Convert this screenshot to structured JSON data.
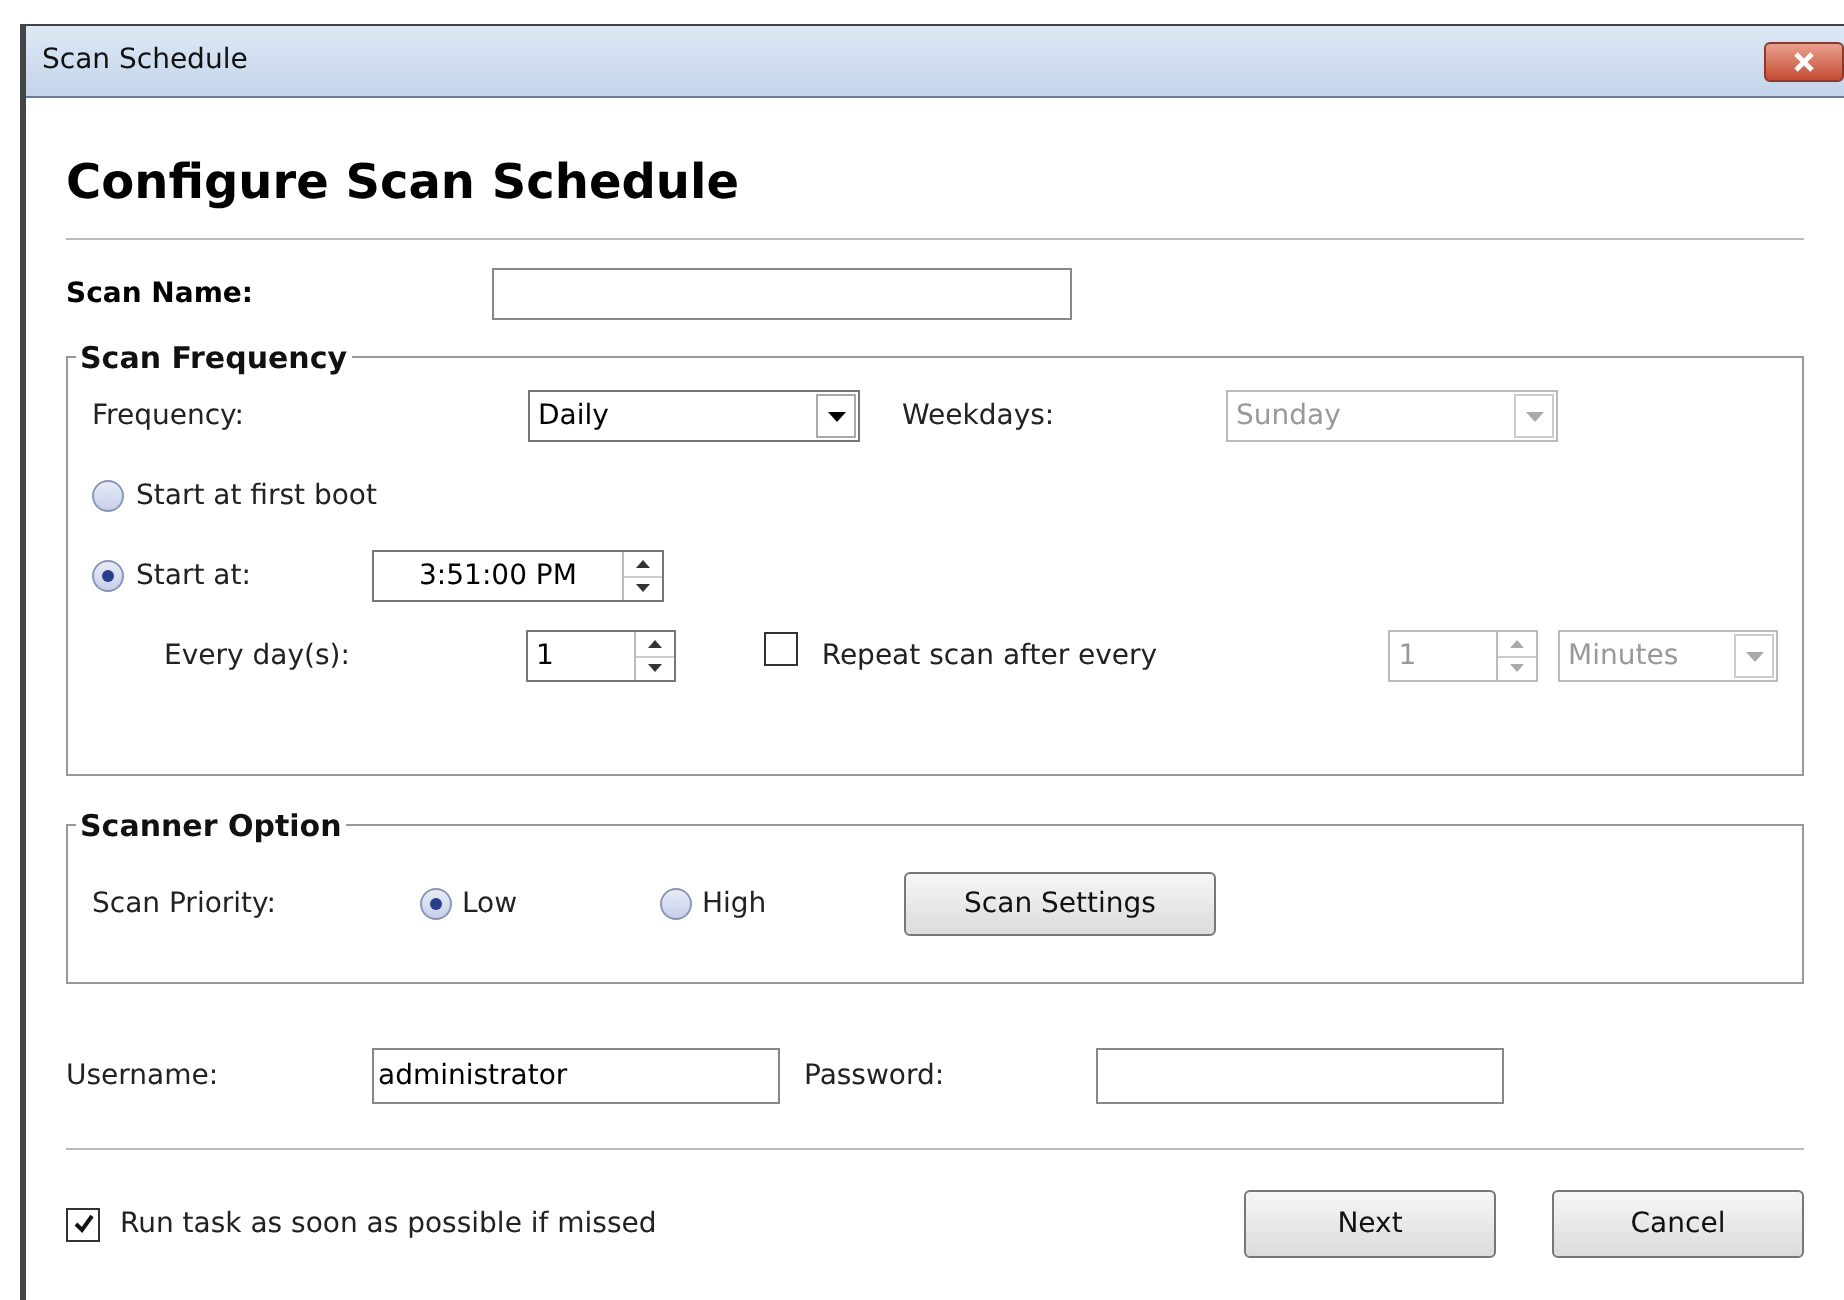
{
  "window": {
    "title": "Scan Schedule"
  },
  "heading": "Configure Scan Schedule",
  "scan_name": {
    "label": "Scan Name:"
  },
  "scan_frequency": {
    "legend": "Scan Frequency",
    "frequency": {
      "label": "Frequency:",
      "value": "Daily",
      "disabled": false
    },
    "weekdays": {
      "label": "Weekdays:",
      "value": "Sunday",
      "disabled": true
    },
    "start_options": [
      {
        "label": "Start at first boot",
        "selected": false
      },
      {
        "label": "Start at:",
        "selected": true,
        "time": "3:51:00 PM"
      }
    ],
    "every_days": {
      "label": "Every day(s):",
      "value": "1"
    },
    "repeat": {
      "label": "Repeat scan after every",
      "checked": false,
      "value": "1",
      "unit": "Minutes",
      "disabled": true
    }
  },
  "scanner_option": {
    "legend": "Scanner Option",
    "priority_label": "Scan Priority:",
    "priorities": [
      {
        "label": "Low",
        "selected": true
      },
      {
        "label": "High",
        "selected": false
      }
    ],
    "settings_button": "Scan Settings"
  },
  "username": {
    "label": "Username:",
    "value": "administrator"
  },
  "password": {
    "label": "Password:"
  },
  "run_if_missed": {
    "label": "Run task as soon as possible if missed",
    "checked": true
  },
  "buttons": [
    "Next",
    "Cancel"
  ]
}
